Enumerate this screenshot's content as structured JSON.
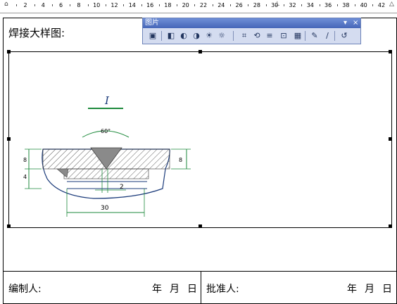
{
  "ruler": {
    "numbers": [
      "2",
      "4",
      "6",
      "8",
      "10",
      "12",
      "14",
      "16",
      "18",
      "20",
      "22",
      "24",
      "26",
      "28",
      "30",
      "32",
      "34",
      "36",
      "38",
      "40",
      "42"
    ]
  },
  "document": {
    "heading": "焊接大样图:",
    "footer_left_label": "编制人:",
    "footer_right_label": "批准人:",
    "date_year": "年",
    "date_month": "月",
    "date_day": "日"
  },
  "drawing": {
    "section_label": "I",
    "angle_label": "60°",
    "dim_left_top": "8",
    "dim_left_bottom": "4",
    "dim_right": "8",
    "dim_gap": "2",
    "dim_width": "30",
    "line_color": "#1e8a3c",
    "body_color": "#1a3a7a"
  },
  "toolbar": {
    "title": "图片",
    "dropdown_glyph": "▾",
    "close_glyph": "×",
    "buttons": [
      {
        "name": "insert-picture-icon",
        "glyph": "▣"
      },
      {
        "name": "color-icon",
        "glyph": "◧"
      },
      {
        "name": "more-contrast-icon",
        "glyph": "◐"
      },
      {
        "name": "less-contrast-icon",
        "glyph": "◑"
      },
      {
        "name": "more-brightness-icon",
        "glyph": "☀"
      },
      {
        "name": "less-brightness-icon",
        "glyph": "☼"
      },
      {
        "name": "crop-icon",
        "glyph": "⌗"
      },
      {
        "name": "rotate-left-icon",
        "glyph": "⟲"
      },
      {
        "name": "line-style-icon",
        "glyph": "≡"
      },
      {
        "name": "compress-picture-icon",
        "glyph": "⊡"
      },
      {
        "name": "text-wrapping-icon",
        "glyph": "▦"
      },
      {
        "name": "format-picture-icon",
        "glyph": "✎"
      },
      {
        "name": "set-transparent-color-icon",
        "glyph": "∕"
      },
      {
        "name": "reset-picture-icon",
        "glyph": "↺"
      }
    ]
  }
}
